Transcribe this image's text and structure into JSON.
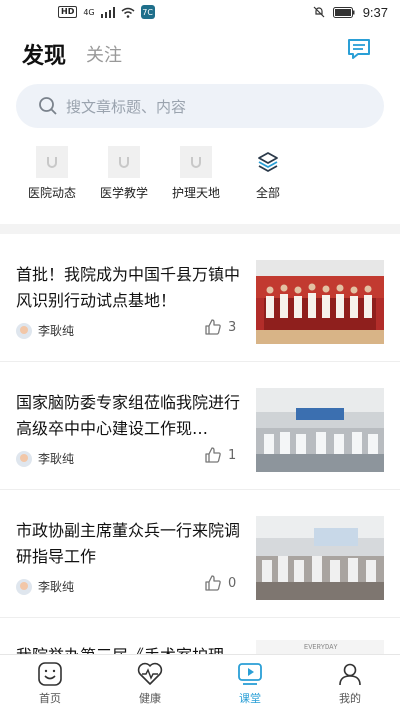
{
  "status_bar": {
    "badge_hd": "HD",
    "net": "4G",
    "app": "7C",
    "time": "9:37"
  },
  "header": {
    "tab_active": "发现",
    "tab_inactive": "关注"
  },
  "search": {
    "placeholder": "搜文章标题、内容"
  },
  "categories": [
    {
      "label": "医院动态"
    },
    {
      "label": "医学教学"
    },
    {
      "label": "护理天地"
    },
    {
      "label": "全部"
    }
  ],
  "articles": [
    {
      "title": "首批！我院成为中国千县万镇中风识别行动试点基地！",
      "author": "李耿纯",
      "likes": "3"
    },
    {
      "title": "国家脑防委专家组莅临我院进行高级卒中中心建设工作现…",
      "author": "李耿纯",
      "likes": "1"
    },
    {
      "title": "市政协副主席董众兵一行来院调研指导工作",
      "author": "李耿纯",
      "likes": "0"
    }
  ],
  "partial_article": {
    "title": "我院举办第三届《手术室护理",
    "img_text": "EVERYDAY"
  },
  "tabbar": [
    {
      "label": "首页"
    },
    {
      "label": "健康"
    },
    {
      "label": "课堂"
    },
    {
      "label": "我的"
    }
  ],
  "colors": {
    "accent": "#2a9fd6",
    "search_bg": "#eef2f8",
    "divider": "#f3f3f3"
  }
}
